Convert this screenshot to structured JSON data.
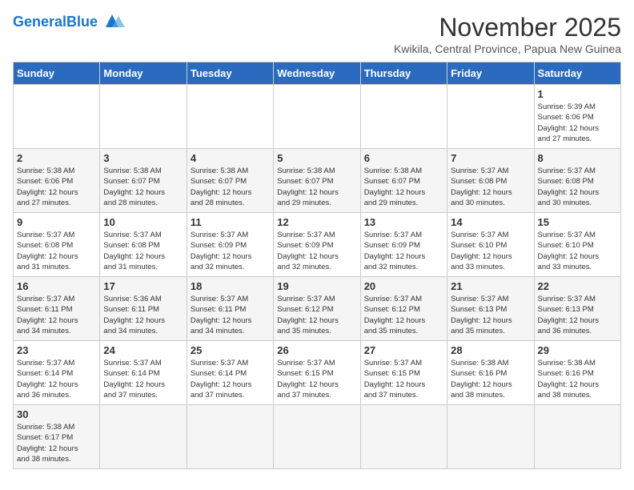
{
  "header": {
    "logo_general": "General",
    "logo_blue": "Blue",
    "month_title": "November 2025",
    "location": "Kwikila, Central Province, Papua New Guinea"
  },
  "weekdays": [
    "Sunday",
    "Monday",
    "Tuesday",
    "Wednesday",
    "Thursday",
    "Friday",
    "Saturday"
  ],
  "weeks": [
    [
      {
        "day": "",
        "info": ""
      },
      {
        "day": "",
        "info": ""
      },
      {
        "day": "",
        "info": ""
      },
      {
        "day": "",
        "info": ""
      },
      {
        "day": "",
        "info": ""
      },
      {
        "day": "",
        "info": ""
      },
      {
        "day": "1",
        "info": "Sunrise: 5:39 AM\nSunset: 6:06 PM\nDaylight: 12 hours\nand 27 minutes."
      }
    ],
    [
      {
        "day": "2",
        "info": "Sunrise: 5:38 AM\nSunset: 6:06 PM\nDaylight: 12 hours\nand 27 minutes."
      },
      {
        "day": "3",
        "info": "Sunrise: 5:38 AM\nSunset: 6:07 PM\nDaylight: 12 hours\nand 28 minutes."
      },
      {
        "day": "4",
        "info": "Sunrise: 5:38 AM\nSunset: 6:07 PM\nDaylight: 12 hours\nand 28 minutes."
      },
      {
        "day": "5",
        "info": "Sunrise: 5:38 AM\nSunset: 6:07 PM\nDaylight: 12 hours\nand 29 minutes."
      },
      {
        "day": "6",
        "info": "Sunrise: 5:38 AM\nSunset: 6:07 PM\nDaylight: 12 hours\nand 29 minutes."
      },
      {
        "day": "7",
        "info": "Sunrise: 5:37 AM\nSunset: 6:08 PM\nDaylight: 12 hours\nand 30 minutes."
      },
      {
        "day": "8",
        "info": "Sunrise: 5:37 AM\nSunset: 6:08 PM\nDaylight: 12 hours\nand 30 minutes."
      }
    ],
    [
      {
        "day": "9",
        "info": "Sunrise: 5:37 AM\nSunset: 6:08 PM\nDaylight: 12 hours\nand 31 minutes."
      },
      {
        "day": "10",
        "info": "Sunrise: 5:37 AM\nSunset: 6:08 PM\nDaylight: 12 hours\nand 31 minutes."
      },
      {
        "day": "11",
        "info": "Sunrise: 5:37 AM\nSunset: 6:09 PM\nDaylight: 12 hours\nand 32 minutes."
      },
      {
        "day": "12",
        "info": "Sunrise: 5:37 AM\nSunset: 6:09 PM\nDaylight: 12 hours\nand 32 minutes."
      },
      {
        "day": "13",
        "info": "Sunrise: 5:37 AM\nSunset: 6:09 PM\nDaylight: 12 hours\nand 32 minutes."
      },
      {
        "day": "14",
        "info": "Sunrise: 5:37 AM\nSunset: 6:10 PM\nDaylight: 12 hours\nand 33 minutes."
      },
      {
        "day": "15",
        "info": "Sunrise: 5:37 AM\nSunset: 6:10 PM\nDaylight: 12 hours\nand 33 minutes."
      }
    ],
    [
      {
        "day": "16",
        "info": "Sunrise: 5:37 AM\nSunset: 6:11 PM\nDaylight: 12 hours\nand 34 minutes."
      },
      {
        "day": "17",
        "info": "Sunrise: 5:36 AM\nSunset: 6:11 PM\nDaylight: 12 hours\nand 34 minutes."
      },
      {
        "day": "18",
        "info": "Sunrise: 5:37 AM\nSunset: 6:11 PM\nDaylight: 12 hours\nand 34 minutes."
      },
      {
        "day": "19",
        "info": "Sunrise: 5:37 AM\nSunset: 6:12 PM\nDaylight: 12 hours\nand 35 minutes."
      },
      {
        "day": "20",
        "info": "Sunrise: 5:37 AM\nSunset: 6:12 PM\nDaylight: 12 hours\nand 35 minutes."
      },
      {
        "day": "21",
        "info": "Sunrise: 5:37 AM\nSunset: 6:13 PM\nDaylight: 12 hours\nand 35 minutes."
      },
      {
        "day": "22",
        "info": "Sunrise: 5:37 AM\nSunset: 6:13 PM\nDaylight: 12 hours\nand 36 minutes."
      }
    ],
    [
      {
        "day": "23",
        "info": "Sunrise: 5:37 AM\nSunset: 6:14 PM\nDaylight: 12 hours\nand 36 minutes."
      },
      {
        "day": "24",
        "info": "Sunrise: 5:37 AM\nSunset: 6:14 PM\nDaylight: 12 hours\nand 37 minutes."
      },
      {
        "day": "25",
        "info": "Sunrise: 5:37 AM\nSunset: 6:14 PM\nDaylight: 12 hours\nand 37 minutes."
      },
      {
        "day": "26",
        "info": "Sunrise: 5:37 AM\nSunset: 6:15 PM\nDaylight: 12 hours\nand 37 minutes."
      },
      {
        "day": "27",
        "info": "Sunrise: 5:37 AM\nSunset: 6:15 PM\nDaylight: 12 hours\nand 37 minutes."
      },
      {
        "day": "28",
        "info": "Sunrise: 5:38 AM\nSunset: 6:16 PM\nDaylight: 12 hours\nand 38 minutes."
      },
      {
        "day": "29",
        "info": "Sunrise: 5:38 AM\nSunset: 6:16 PM\nDaylight: 12 hours\nand 38 minutes."
      }
    ],
    [
      {
        "day": "30",
        "info": "Sunrise: 5:38 AM\nSunset: 6:17 PM\nDaylight: 12 hours\nand 38 minutes."
      },
      {
        "day": "",
        "info": ""
      },
      {
        "day": "",
        "info": ""
      },
      {
        "day": "",
        "info": ""
      },
      {
        "day": "",
        "info": ""
      },
      {
        "day": "",
        "info": ""
      },
      {
        "day": "",
        "info": ""
      }
    ]
  ]
}
